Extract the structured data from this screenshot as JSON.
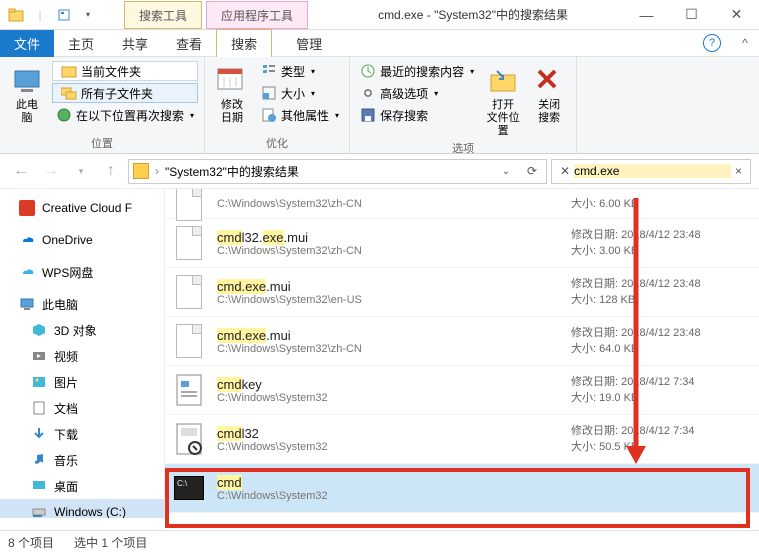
{
  "title": "cmd.exe - \"System32\"中的搜索结果",
  "tool_tab1": {
    "header": "搜索工具"
  },
  "tool_tab2": {
    "header": "应用程序工具"
  },
  "tabs": {
    "file": "文件",
    "home": "主页",
    "share": "共享",
    "view": "查看",
    "search": "搜索",
    "manage": "管理"
  },
  "ribbon": {
    "location": {
      "this_pc": "此电\n脑",
      "current_folder": "当前文件夹",
      "all_subfolders": "所有子文件夹",
      "search_again": "在以下位置再次搜索",
      "group": "位置"
    },
    "refine": {
      "modify_date": "修改\n日期",
      "kind": "类型",
      "size": "大小",
      "other_props": "其他属性",
      "group": "优化"
    },
    "options": {
      "recent_searches": "最近的搜索内容",
      "advanced_options": "高级选项",
      "save_search": "保存搜索",
      "open_location": "打开\n文件位置",
      "close_search": "关闭\n搜索",
      "group": "选项"
    }
  },
  "address": {
    "text": "\"System32\"中的搜索结果",
    "search_value": "cmd.exe"
  },
  "sidebar": {
    "items": [
      {
        "label": "Creative Cloud F",
        "icon": "cc"
      },
      {
        "label": "OneDrive",
        "icon": "cloud-blue"
      },
      {
        "label": "WPS网盘",
        "icon": "cloud-wps"
      },
      {
        "label": "此电脑",
        "icon": "pc"
      },
      {
        "label": "3D 对象",
        "icon": "3d"
      },
      {
        "label": "视频",
        "icon": "video"
      },
      {
        "label": "图片",
        "icon": "pictures"
      },
      {
        "label": "文档",
        "icon": "documents"
      },
      {
        "label": "下载",
        "icon": "downloads"
      },
      {
        "label": "音乐",
        "icon": "music"
      },
      {
        "label": "桌面",
        "icon": "desktop"
      },
      {
        "label": "Windows (C:)",
        "icon": "disk"
      }
    ]
  },
  "results": [
    {
      "name_pre": "",
      "name_hl": "",
      "name_post": "",
      "path": "C:\\Windows\\System32\\zh-CN",
      "date": "",
      "size": "6.00 KB",
      "icon": "file",
      "partial": true
    },
    {
      "name_pre": "",
      "name_hl": "cmd",
      "name_mid": "l32.",
      "name_hl2": "exe",
      "name_post": ".mui",
      "path": "C:\\Windows\\System32\\zh-CN",
      "date": "2018/4/12 23:48",
      "size": "3.00 KB",
      "icon": "file"
    },
    {
      "name_pre": "",
      "name_hl": "cmd.exe",
      "name_post": ".mui",
      "path": "C:\\Windows\\System32\\en-US",
      "date": "2018/4/12 23:48",
      "size": "128 KB",
      "icon": "file"
    },
    {
      "name_pre": "",
      "name_hl": "cmd.exe",
      "name_post": ".mui",
      "path": "C:\\Windows\\System32\\zh-CN",
      "date": "2018/4/12 23:48",
      "size": "64.0 KB",
      "icon": "file"
    },
    {
      "name_pre": "",
      "name_hl": "cmd",
      "name_post": "key",
      "path": "C:\\Windows\\System32",
      "date": "2018/4/12 7:34",
      "size": "19.0 KB",
      "icon": "app1"
    },
    {
      "name_pre": "",
      "name_hl": "cmd",
      "name_post": "l32",
      "path": "C:\\Windows\\System32",
      "date": "2018/4/12 7:34",
      "size": "50.5 KB",
      "icon": "app2"
    },
    {
      "name_pre": "",
      "name_hl": "cmd",
      "name_post": "",
      "path": "C:\\Windows\\System32",
      "date": "",
      "size": "",
      "icon": "exe",
      "selected": true
    }
  ],
  "meta_labels": {
    "date": "修改日期:",
    "size": "大小:"
  },
  "status": {
    "count": "8 个项目",
    "selected": "选中 1 个项目"
  }
}
